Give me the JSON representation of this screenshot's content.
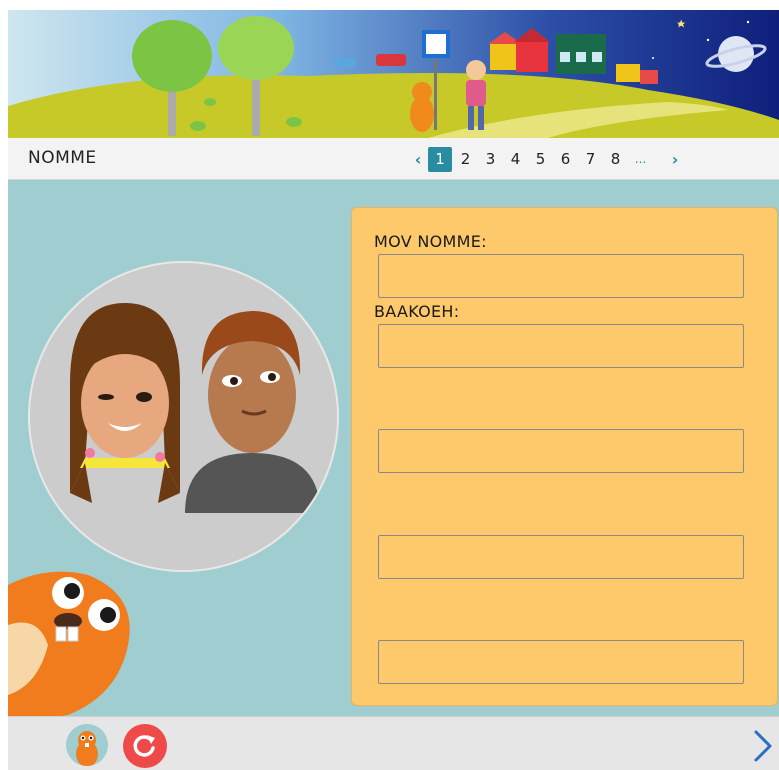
{
  "header": {
    "title": "NOMME"
  },
  "pager": {
    "prev_symbol": "‹",
    "next_symbol": "›",
    "pages": [
      "1",
      "2",
      "3",
      "4",
      "5",
      "6",
      "7",
      "8"
    ],
    "active_page": "1",
    "ellipsis": "..."
  },
  "form": {
    "field1_label": "MOV NOMME:",
    "field2_label": "BAAKOEH:",
    "field1_value": "",
    "field2_value": "",
    "field3_value": "",
    "field4_value": "",
    "field5_value": ""
  },
  "colors": {
    "background": "#9fcdd0",
    "panel": "#fdc96b",
    "accent": "#2a8ca0",
    "reset": "#ef4a4a"
  },
  "icons": {
    "next": "chevron-right-icon",
    "reset": "refresh-icon",
    "avatar": "beaver-avatar-icon"
  }
}
